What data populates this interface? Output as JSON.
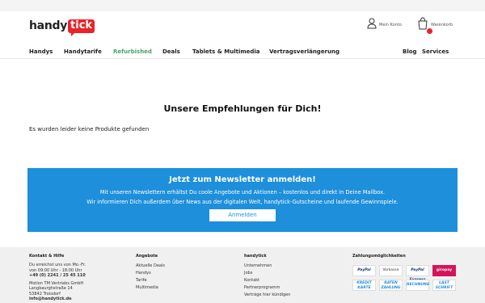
{
  "header": {
    "logo_text": "handy",
    "logo_badge": "tick",
    "account_label": "Mein Konto",
    "cart_label": "Warenkorb",
    "brand_color": "#e8242b"
  },
  "nav": {
    "items": [
      "Handys",
      "Handytarife",
      "Refurbished",
      "Deals",
      "Tablets & Multimedia",
      "Vertragsverlängerung"
    ],
    "right_items": [
      "Blog",
      "Services"
    ],
    "active_color": "#4aa36b"
  },
  "main": {
    "title": "Unsere Empfehlungen für Dich!",
    "no_products": "Es wurden leider keine Produkte gefunden"
  },
  "newsletter": {
    "heading": "Jetzt zum Newsletter anmelden!",
    "text1": "Mit unseren Newslettern erhältst Du coole Angebote und Aktionen – kostenlos und direkt in Deine Mailbox.",
    "text2": "Wir informieren Dich außerdem über News aus der digitalen Welt, handytick-Gutscheine und laufende Gewinnspiele.",
    "button": "Anmelden",
    "bg_color": "#1e8fdb"
  },
  "footer": {
    "contact": {
      "heading": "Kontakt & Hilfe",
      "lines": [
        "Du erreichst uns von Mo.-Fr.",
        "von 09:00 Uhr - 18:00 Uhr",
        "+49 (0) 2241 / 25 45 110",
        "",
        "Motion TM Vertriebs GmbH",
        "Langbaurghstraße 14",
        "53842 Troisdorf",
        "info@handytick.de"
      ]
    },
    "offers": {
      "heading": "Angebote",
      "links": [
        "Aktuelle Deals",
        "Handys",
        "Tarife",
        "Multimedia"
      ]
    },
    "company": {
      "heading": "handytick",
      "links": [
        "Unternehmen",
        "Jobs",
        "Kontakt",
        "Partnerprogramm",
        "Verträge hier kündigen"
      ]
    },
    "payment": {
      "heading": "Zahlungsmöglichkeiten",
      "methods": [
        "PayPal",
        "Vorkasse",
        "PayPal Express",
        "giropay",
        "KREDIT KARTE",
        "RATEN ZAHLUNG",
        "RECHNUNG",
        "LAST SCHRIFT"
      ]
    }
  }
}
